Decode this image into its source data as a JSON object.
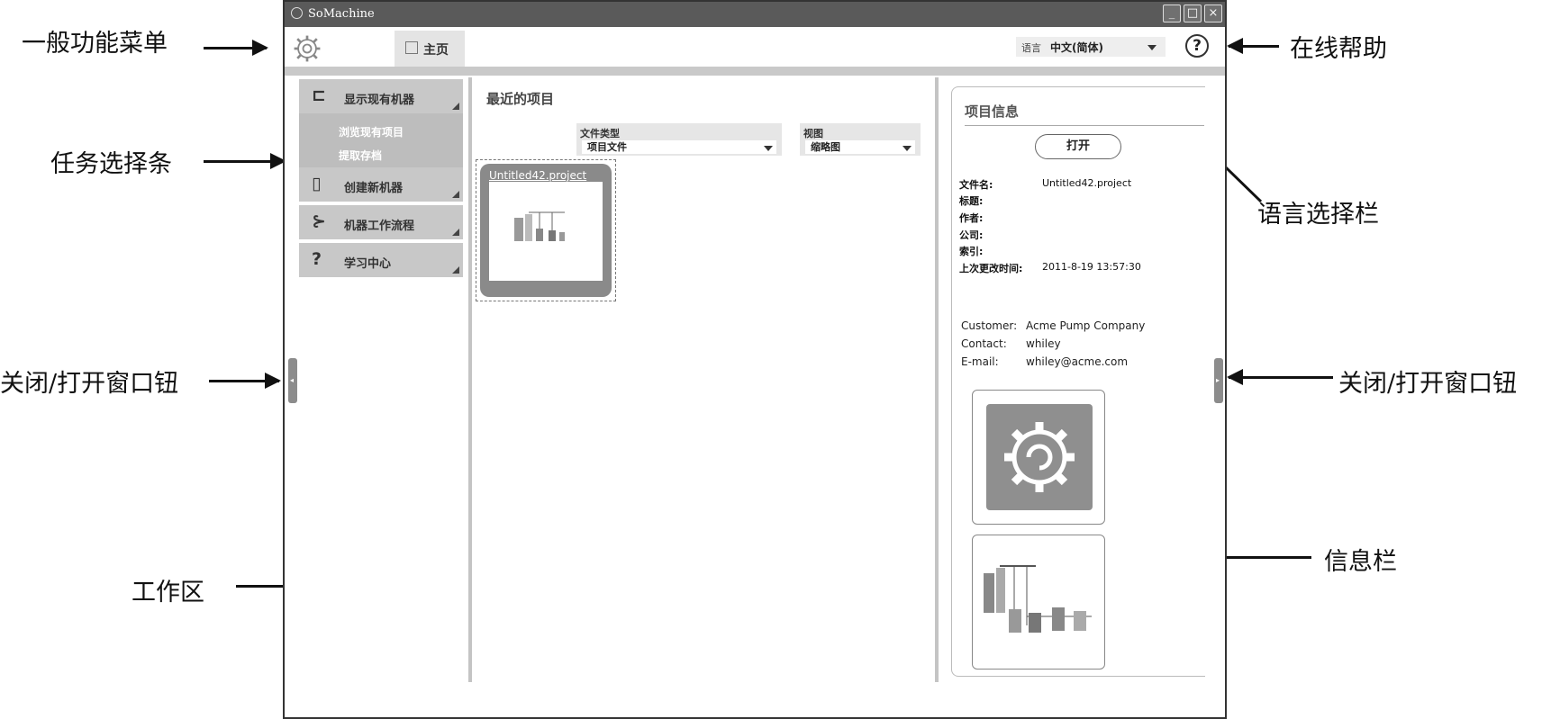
{
  "window": {
    "title": "SoMachine"
  },
  "toolbar": {
    "home_tab": "主页",
    "language_label": "语言",
    "language_value": "中文(简体)",
    "help_symbol": "?"
  },
  "taskbar": {
    "items": [
      {
        "label": "显示现有机器",
        "icon": "folder-open-icon"
      },
      {
        "label": "创建新机器",
        "icon": "new-document-icon"
      },
      {
        "label": "机器工作流程",
        "icon": "workflow-icon"
      },
      {
        "label": "学习中心",
        "icon": "question-icon"
      }
    ],
    "subitems": [
      "浏览现有项目",
      "提取存档"
    ]
  },
  "workarea": {
    "title": "最近的项目",
    "filetype_label": "文件类型",
    "filetype_value": "项目文件",
    "view_label": "视图",
    "view_value": "缩略图",
    "project_name": "Untitled42.project"
  },
  "info": {
    "title": "项目信息",
    "open_button": "打开",
    "fields": [
      {
        "key": "文件名:",
        "value": "Untitled42.project"
      },
      {
        "key": "标题:",
        "value": ""
      },
      {
        "key": "作者:",
        "value": ""
      },
      {
        "key": "公司:",
        "value": ""
      },
      {
        "key": "索引:",
        "value": ""
      },
      {
        "key": "上次更改时间:",
        "value": "2011-8-19 13:57:30"
      }
    ],
    "customer": [
      {
        "key": "Customer:",
        "value": "Acme Pump Company"
      },
      {
        "key": "Contact:",
        "value": "whiley"
      },
      {
        "key": "E-mail:",
        "value": "whiley@acme.com"
      }
    ]
  },
  "annotations": {
    "general_menu": "一般功能菜单",
    "task_bar": "任务选择条",
    "close_open_left": "关闭/打开窗口钮",
    "work_area": "工作区",
    "online_help": "在线帮助",
    "language_bar": "语言选择栏",
    "close_open_right": "关闭/打开窗口钮",
    "info_bar": "信息栏"
  }
}
